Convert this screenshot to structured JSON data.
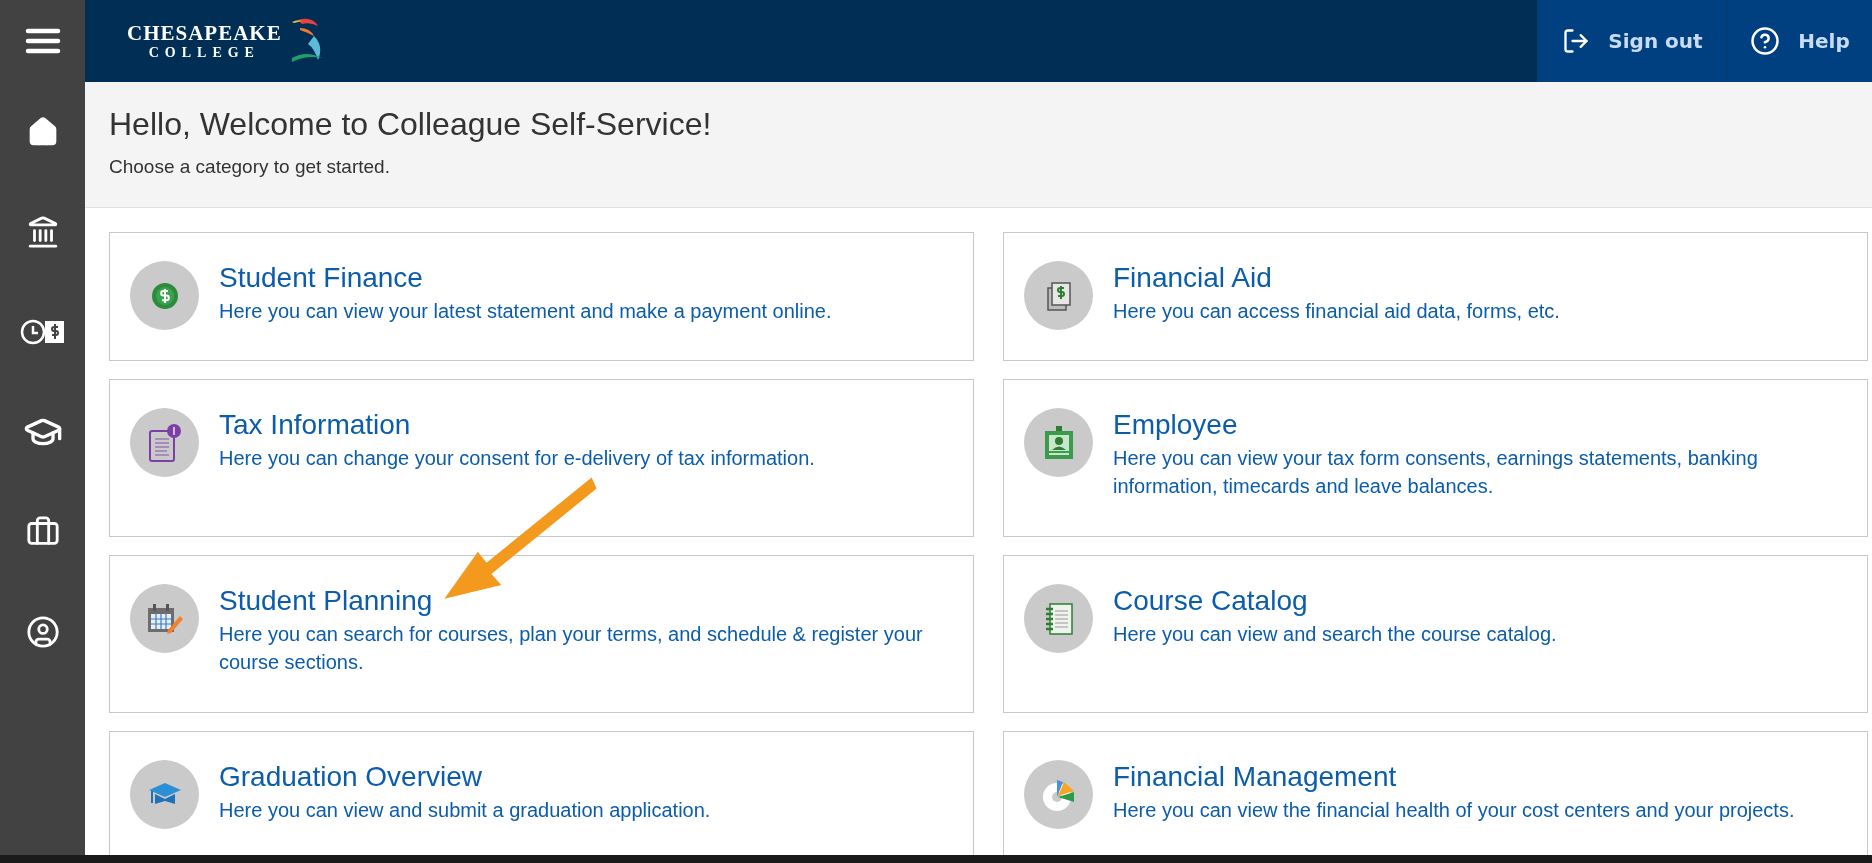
{
  "header": {
    "logo": {
      "line_1": "CHESAPEAKE",
      "line_2": "COLLEGE"
    },
    "actions": [
      {
        "label": "Sign out"
      },
      {
        "label": "Help"
      }
    ]
  },
  "welcome": {
    "title": "Hello, Welcome to Colleague Self-Service!",
    "subtitle": "Choose a category to get started."
  },
  "categories": [
    {
      "title": "Student Finance",
      "description": "Here you can view your latest statement and make a payment online."
    },
    {
      "title": "Financial Aid",
      "description": "Here you can access financial aid data, forms, etc."
    },
    {
      "title": "Tax Information",
      "description": "Here you can change your consent for e-delivery of tax information."
    },
    {
      "title": "Employee",
      "description": "Here you can view your tax form consents, earnings statements, banking information, timecards and leave balances."
    },
    {
      "title": "Student Planning",
      "description": "Here you can search for courses, plan your terms, and schedule & register your course sections."
    },
    {
      "title": "Course Catalog",
      "description": "Here you can view and search the course catalog."
    },
    {
      "title": "Graduation Overview",
      "description": "Here you can view and submit a graduation application."
    },
    {
      "title": "Financial Management",
      "description": "Here you can view the financial health of your cost centers and your projects."
    }
  ]
}
